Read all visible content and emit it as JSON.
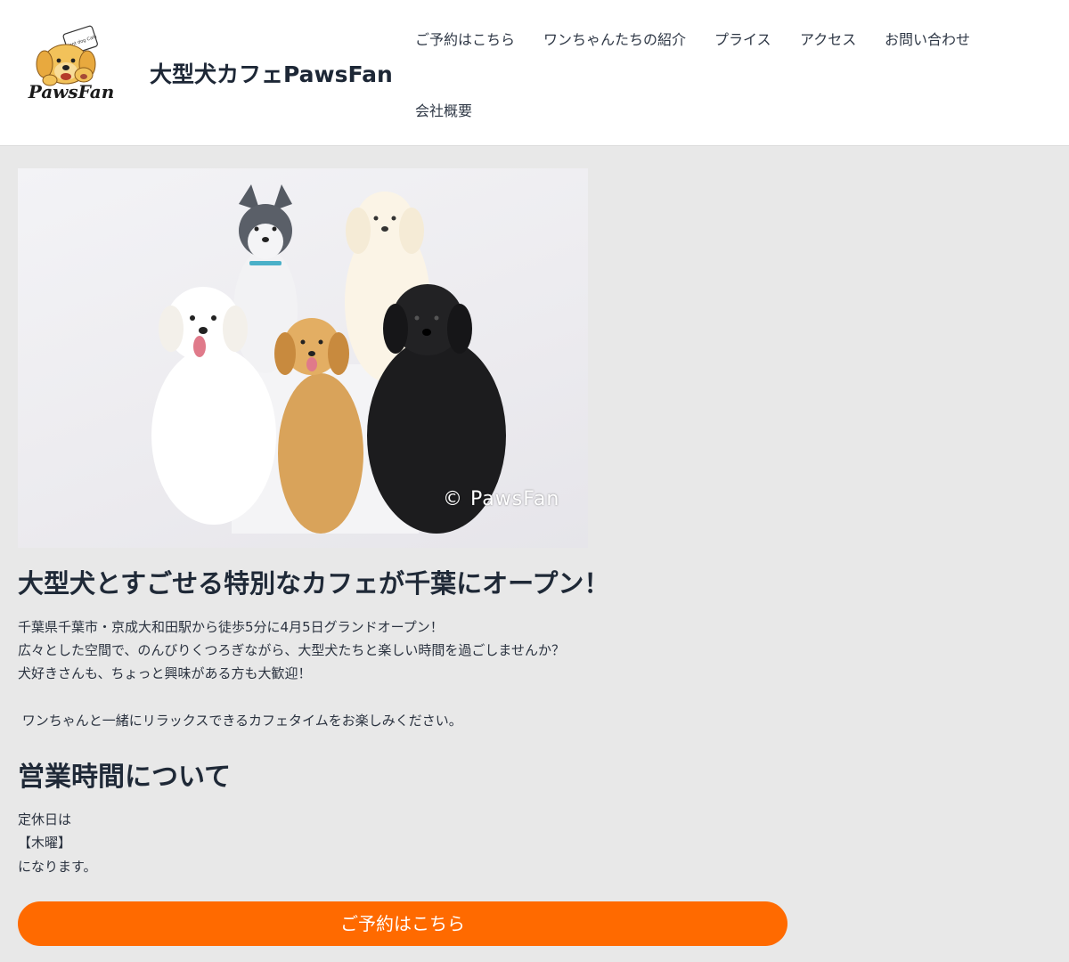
{
  "site": {
    "title": "大型犬カフェPawsFan",
    "logo_text": "PawsFan",
    "logo_badge": "Giant dog Cafe"
  },
  "nav": {
    "items": [
      {
        "label": "ご予約はこちら"
      },
      {
        "label": "ワンちゃんたちの紹介"
      },
      {
        "label": "プライス"
      },
      {
        "label": "アクセス"
      },
      {
        "label": "お問い合わせ"
      },
      {
        "label": "会社概要"
      }
    ]
  },
  "hero": {
    "watermark": "© PawsFan"
  },
  "intro": {
    "heading": "大型犬とすごせる特別なカフェが千葉にオープン！",
    "lines": [
      "千葉県千葉市・京成大和田駅から徒歩5分に4月5日グランドオープン！",
      "広々とした空間で、のんびりくつろぎながら、大型犬たちと楽しい時間を過ごしませんか？",
      "犬好きさんも、ちょっと興味がある方も大歓迎！",
      " ワンちゃんと一緒にリラックスできるカフェタイムをお楽しみください。"
    ]
  },
  "hours": {
    "heading": "営業時間について",
    "lines": [
      "定休日は",
      "【木曜】",
      "になります。"
    ]
  },
  "cta": {
    "label": "ご予約はこちら",
    "color": "#ff6a00"
  },
  "colors": {
    "page_bg": "#e8e8e8",
    "header_bg": "#ffffff",
    "accent": "#ff6a00",
    "text": "#1f2937"
  }
}
